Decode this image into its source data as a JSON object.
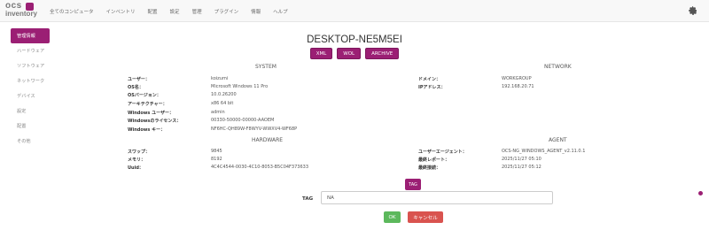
{
  "app": {
    "logo_top": "ocs",
    "logo_bottom": "inventory"
  },
  "nav": {
    "items": [
      "全てのコンピュータ",
      "インベントリ",
      "配置",
      "設定",
      "管理",
      "プラグイン",
      "情報",
      "ヘルプ"
    ],
    "settings_icon": "gear-icon"
  },
  "sidebar": {
    "items": [
      "管理情報",
      "ハードウェア",
      "ソフトウェア",
      "ネットワーク",
      "デバイス",
      "設定",
      "配置",
      "その他"
    ],
    "active_index": 0
  },
  "device": {
    "name": "DESKTOP-NE5M5EI"
  },
  "actions": [
    "XML",
    "WOL",
    "ARCHIVE"
  ],
  "system": {
    "title": "SYSTEM",
    "rows": [
      {
        "label": "ユーザー：",
        "value": "koizumi"
      },
      {
        "label": "OS名：",
        "value": "Microsoft Windows 11 Pro"
      },
      {
        "label": "OSバージョン：",
        "value": "10.0.26200"
      },
      {
        "label": "アーキテクチャー：",
        "value": "x86 64 bit"
      },
      {
        "label": "Windows ユーザー：",
        "value": "admin"
      },
      {
        "label": "Windowsのライセンス：",
        "value": "00330-50000-00000-AAOEM"
      },
      {
        "label": "Windows キー：",
        "value": "NF6HC-QH89W-F8WYV-WWXV4-WF68P"
      }
    ]
  },
  "network": {
    "title": "NETWORK",
    "rows": [
      {
        "label": "ドメイン：",
        "value": "WORKGROUP"
      },
      {
        "label": "IPアドレス：",
        "value": "192.168.20.71"
      }
    ]
  },
  "hardware": {
    "title": "HARDWARE",
    "rows": [
      {
        "label": "スワップ：",
        "value": "9845"
      },
      {
        "label": "メモリ：",
        "value": "8192"
      },
      {
        "label": "Uuid：",
        "value": "4C4C4544-0030-4C10-8053-B5C04F373633"
      }
    ]
  },
  "agent": {
    "title": "AGENT",
    "rows": [
      {
        "label": "ユーザーエージェント：",
        "value": "OCS-NG_WINDOWS_AGENT_v2.11.0.1"
      },
      {
        "label": "最終レポート：",
        "value": "2025/11/27 05:10"
      },
      {
        "label": "最終接続：",
        "value": "2025/11/27 05:12"
      }
    ]
  },
  "tag": {
    "button": "TAG",
    "label": "TAG",
    "value": "NA"
  },
  "footer": {
    "ok": "OK",
    "cancel": "キャンセル"
  },
  "colors": {
    "accent": "#9b1f74",
    "ok": "#5cb85c",
    "cancel": "#d9534f"
  }
}
